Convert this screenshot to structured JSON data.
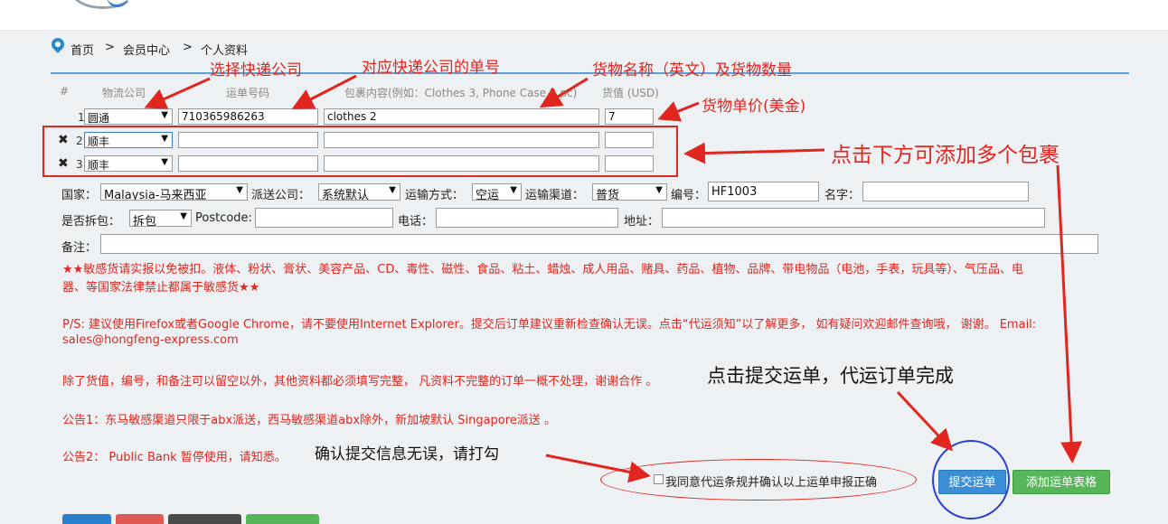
{
  "breadcrumb": {
    "home": "首页",
    "sep1": ">",
    "member": "会员中心",
    "sep2": ">",
    "profile": "个人资料"
  },
  "table": {
    "headers": {
      "num": "#",
      "carrier": "物流公司",
      "tracking": "运单号码",
      "contents": "包裹内容(例如：Clothes 3, Phone Case 2 pc)",
      "value": "货值 (USD)"
    },
    "rows": [
      {
        "num": "1",
        "carrier": "圆通",
        "tracking": "710365986263",
        "contents": "clothes 2",
        "value": "7"
      },
      {
        "num": "2",
        "carrier": "顺丰",
        "tracking": "",
        "contents": "",
        "value": ""
      },
      {
        "num": "3",
        "carrier": "顺丰",
        "tracking": "",
        "contents": "",
        "value": ""
      }
    ]
  },
  "form": {
    "country_label": "国家：",
    "country_value": "Malaysia-马来西亚",
    "delivery_label": "派送公司：",
    "delivery_value": "系统默认",
    "transport_label": "运输方式：",
    "transport_value": "空运",
    "channel_label": "运输渠道：",
    "channel_value": "普货",
    "code_label": "编号：",
    "code_value": "HF1003",
    "name_label": "名字：",
    "unpack_label": "是否拆包：",
    "unpack_value": "拆包",
    "postcode_label": "Postcode:",
    "phone_label": "电话：",
    "address_label": "地址：",
    "remark_label": "备注："
  },
  "notices": {
    "sensitive_1": "★★敏感货请实报以免被扣。液体、粉状、膏状、美容产品、CD、毒性、磁性、食品、粘土、蜡烛、成人用品、赌具、药品、植物、品牌、带电物品（电池，手表，玩具等）、气压品、电",
    "sensitive_2": "器、等国家法律禁止都属于敏感货★★",
    "ps_1": "P/S: 建议使用Firefox或者Google Chrome，请不要使用Internet Explorer。提交后订单建议重新检查确认无误。点击“代运须知”以了解更多， 如有疑问欢迎邮件查询哦， 谢谢。 Email:",
    "ps_2": "sales@hongfeng-express.com",
    "required": "除了货值，编号，和备注可以留空以外，其他资料都必须填写完整， 凡资料不完整的订单一概不处理，谢谢合作 。",
    "announce_1": "公告1：东马敏感渠道只限于abx派送，西马敏感渠道abx除外，新加坡默认 Singapore派送 。",
    "announce_2": "公告2： Public Bank 暂停使用，请知悉。"
  },
  "agree_label": "我同意代运条规并确认以上运单申报正确",
  "buttons": {
    "submit": "提交运单",
    "add_table": "添加运单表格"
  },
  "annotations": {
    "choose_carrier": "选择快递公司",
    "tracking_no": "对应快递公司的单号",
    "goods_name": "货物名称（英文）及货物数量",
    "unit_price": "货物单价(美金)",
    "add_more": "点击下方可添加多个包裹",
    "click_submit": "点击提交运单，代运订单完成",
    "confirm_check": "确认提交信息无误，请打勾"
  },
  "colors": {
    "accent_red": "#e0261e",
    "blue": "#3b8fd7",
    "green": "#57b65a",
    "circle": "#2a3fd0"
  },
  "icons": {
    "delete": "x-icon",
    "location": "map-pin-icon",
    "dropdown": "chevron-down-icon"
  }
}
